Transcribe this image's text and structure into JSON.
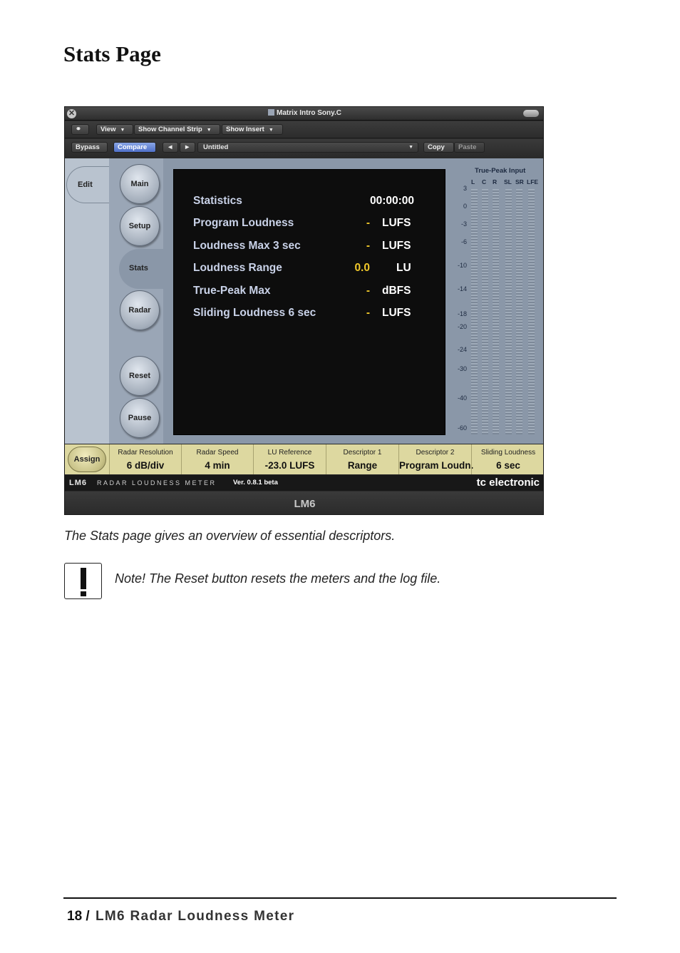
{
  "page": {
    "title": "Stats Page",
    "caption": "The Stats page gives an overview of essential descriptors.",
    "note": "Note! The Reset button resets the meters and the log file.",
    "footer_page_num": "18 /",
    "footer_doc_name": "LM6 Radar Loudness Meter"
  },
  "window": {
    "title": "Matrix Intro Sony.C",
    "close_glyph": "✕"
  },
  "toolbar": {
    "view": "View",
    "show_channel_strip": "Show Channel Strip",
    "show_insert": "Show Insert",
    "bypass": "Bypass",
    "compare": "Compare",
    "prev": "◄",
    "next": "►",
    "preset": "Untitled",
    "copy": "Copy",
    "paste": "Paste"
  },
  "nav": {
    "edit": "Edit",
    "main": "Main",
    "setup": "Setup",
    "stats": "Stats",
    "radar": "Radar",
    "reset": "Reset",
    "pause": "Pause"
  },
  "stats": {
    "header_label": "Statistics",
    "time": "00:00:00",
    "rows": [
      {
        "label": "Program Loudness",
        "value": "-",
        "unit": "LUFS"
      },
      {
        "label": "Loudness Max 3 sec",
        "value": "-",
        "unit": "LUFS"
      },
      {
        "label": "Loudness Range",
        "value": "0.0",
        "unit": "LU"
      },
      {
        "label": "True-Peak Max",
        "value": "-",
        "unit": "dBFS"
      },
      {
        "label": "Sliding Loudness 6 sec",
        "value": "-",
        "unit": "LUFS"
      }
    ]
  },
  "meters": {
    "title": "True-Peak Input",
    "channels": [
      "L",
      "C",
      "R",
      "SL",
      "SR",
      "LFE"
    ],
    "scale": [
      "3",
      "0",
      "-3",
      "-6",
      "-10",
      "-14",
      "-18",
      "-20",
      "-24",
      "-30",
      "-40",
      "-60"
    ]
  },
  "params": {
    "assign": "Assign",
    "items": [
      {
        "label": "Radar Resolution",
        "value": "6 dB/div"
      },
      {
        "label": "Radar Speed",
        "value": "4 min"
      },
      {
        "label": "LU Reference",
        "value": "-23.0 LUFS"
      },
      {
        "label": "Descriptor 1",
        "value": "Range"
      },
      {
        "label": "Descriptor 2",
        "value": "Program Loudn."
      },
      {
        "label": "Sliding Loudness",
        "value": "6 sec"
      }
    ]
  },
  "brand": {
    "model": "LM6",
    "subtitle": "RADAR LOUDNESS METER",
    "version": "Ver. 0.8.1 beta",
    "maker": "tc electronic",
    "footer_label": "LM6"
  }
}
